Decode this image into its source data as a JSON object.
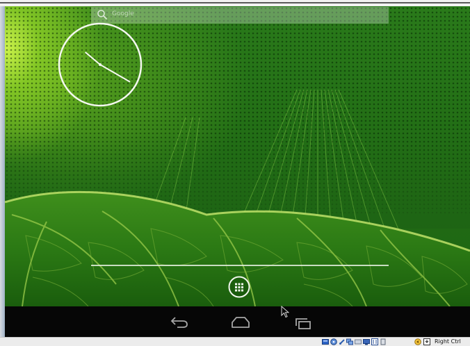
{
  "search": {
    "label": "Google"
  },
  "clock": {
    "hour": 10,
    "minute": 20
  },
  "navbar": {
    "back_icon": "back-arrow-icon",
    "home_icon": "home-icon",
    "recents_icon": "recent-apps-icon"
  },
  "launcher": {
    "all_apps_icon": "app-drawer-icon"
  },
  "host_status": {
    "tray_icons": [
      "hard-disk-icon",
      "optical-drive-icon",
      "usb-icon",
      "network-icon",
      "shared-folders-icon",
      "display-icon",
      "video-capture-icon",
      "cpu-icon",
      "mouse-integration-icon",
      "keyboard-icon"
    ],
    "host_key_label": "Right Ctrl"
  },
  "colors": {
    "wallpaper_base": "#1f6a14",
    "glow": "#d6fa4e",
    "navbar": "#060606",
    "nav_icon": "#a6a6a6"
  }
}
